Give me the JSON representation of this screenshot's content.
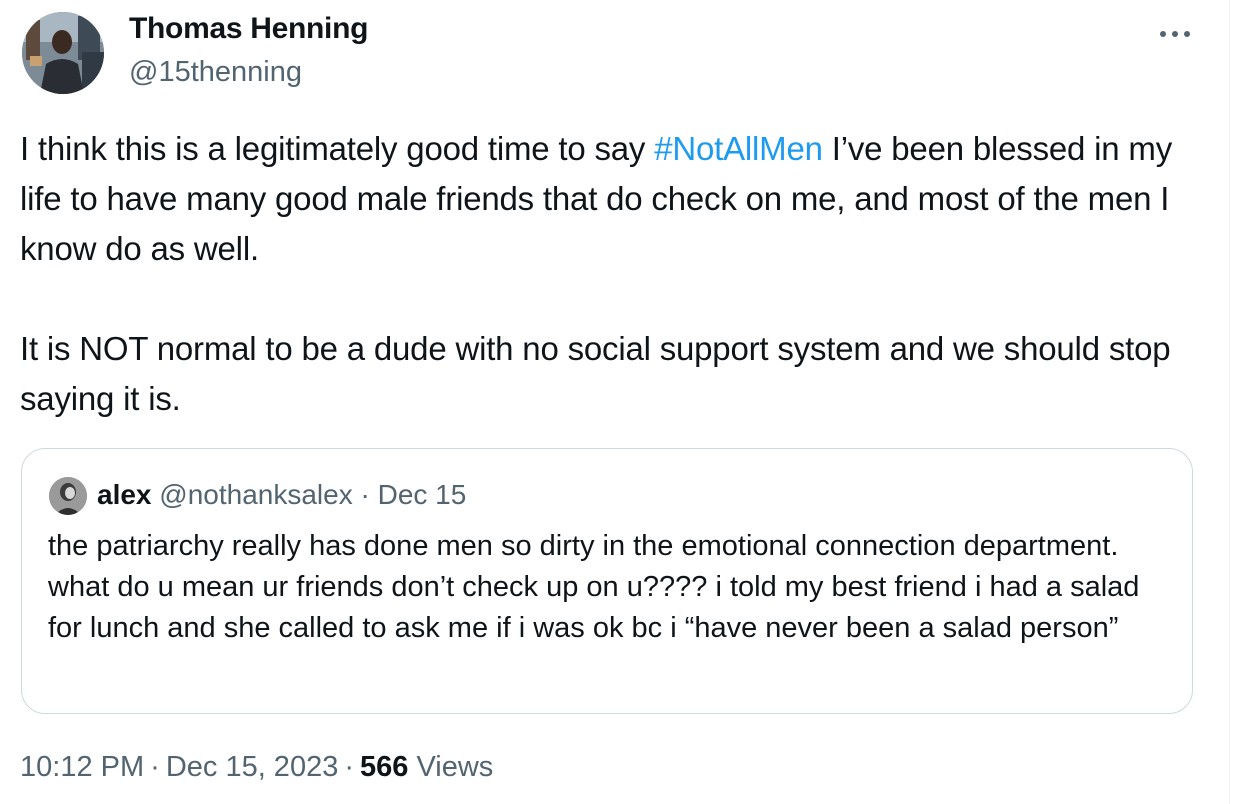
{
  "author": {
    "name": "Thomas Henning",
    "handle": "@15thenning"
  },
  "tweet": {
    "text_part1": "I think this is a legitimately good time to say ",
    "hashtag": "#NotAllMen",
    "text_part2": " I’ve been blessed in my life to have many good male friends that do check on me, and most of the men I know do as well.",
    "paragraph2": "It is NOT normal to be a dude with no social support system and we should stop saying it is."
  },
  "quote": {
    "name": "alex",
    "handle": "@nothanksalex",
    "separator": " · ",
    "date": "Dec 15",
    "text": "the patriarchy really has done men so dirty in the emotional connection department. what do u mean ur friends don’t check up on u???? i told my best friend i had a salad for lunch and she called to ask me if i was ok bc i “have never been a salad person”"
  },
  "footer": {
    "time": "10:12 PM",
    "dot": "·",
    "date": "Dec 15, 2023",
    "views_count": "566",
    "views_label": "Views"
  },
  "icons": {
    "more": "more-horizontal-icon"
  },
  "colors": {
    "accent": "#1d9bf0",
    "secondary_text": "#536471",
    "primary_text": "#0f1419",
    "border": "#cfd9de"
  }
}
